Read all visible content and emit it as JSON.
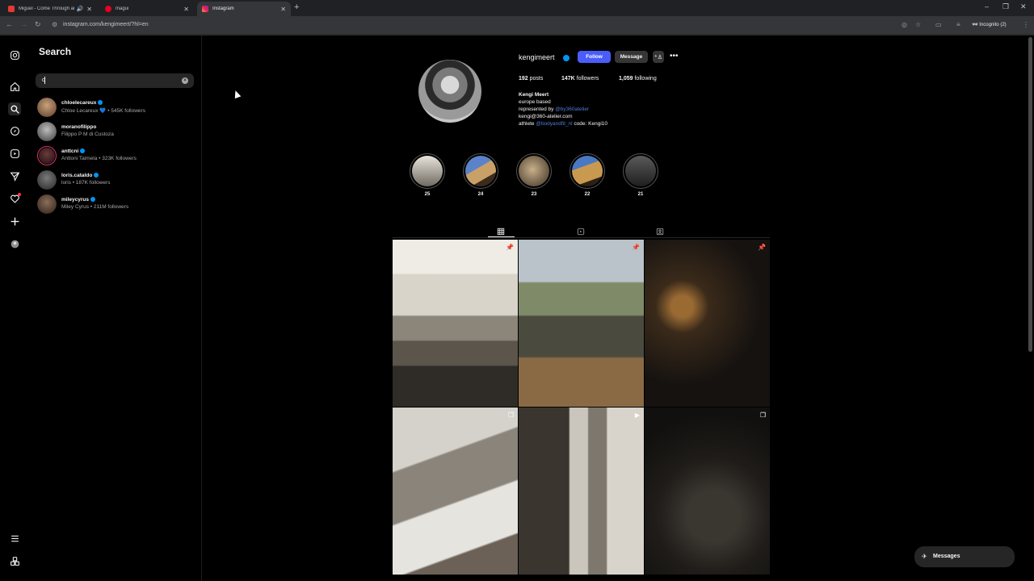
{
  "browser": {
    "tabs": [
      {
        "title": "Miguel - Come Through an",
        "active": false
      },
      {
        "title": "magui",
        "active": false
      },
      {
        "title": "Instagram",
        "active": true
      }
    ],
    "url": "instagram.com/kengimeert/?hl=en",
    "profile_badge": "Incognito (2)"
  },
  "search": {
    "title": "Search",
    "query": "c",
    "results": [
      {
        "username": "chloelecareux",
        "verified": true,
        "subtitle": "Chloe Lecareux 💙 • 545K followers"
      },
      {
        "username": "moranofilippo",
        "verified": false,
        "subtitle": "Filippo P M di Custoza"
      },
      {
        "username": "anttcni",
        "verified": true,
        "subtitle": "Anttoni Taimela • 323K followers"
      },
      {
        "username": "loris.cataldo",
        "verified": true,
        "subtitle": "loris • 187K followers"
      },
      {
        "username": "mileycyrus",
        "verified": true,
        "subtitle": "Miley Cyrus • 211M followers"
      }
    ]
  },
  "profile": {
    "username": "kengimeert",
    "follow_label": "Follow",
    "message_label": "Message",
    "stats": {
      "posts_count": "192",
      "posts_label": "posts",
      "followers_count": "147K",
      "followers_label": "followers",
      "following_count": "1,059",
      "following_label": "following"
    },
    "bio": {
      "name": "Kengi Meert",
      "line1": "europe based",
      "line2_prefix": "represented by",
      "line2_link": "@by360atelier",
      "line3": "kengi@360-atelier.com",
      "line4_prefix": "athlete",
      "line4_link": "@bodyandfit_nl",
      "line4_suffix": "code: Kengi10"
    },
    "highlights": [
      "25",
      "24",
      "23",
      "22",
      "21"
    ]
  },
  "messages_label": "Messages",
  "colors": {
    "accent": "#4a5df9",
    "verified": "#0095f6",
    "background": "#000000"
  }
}
